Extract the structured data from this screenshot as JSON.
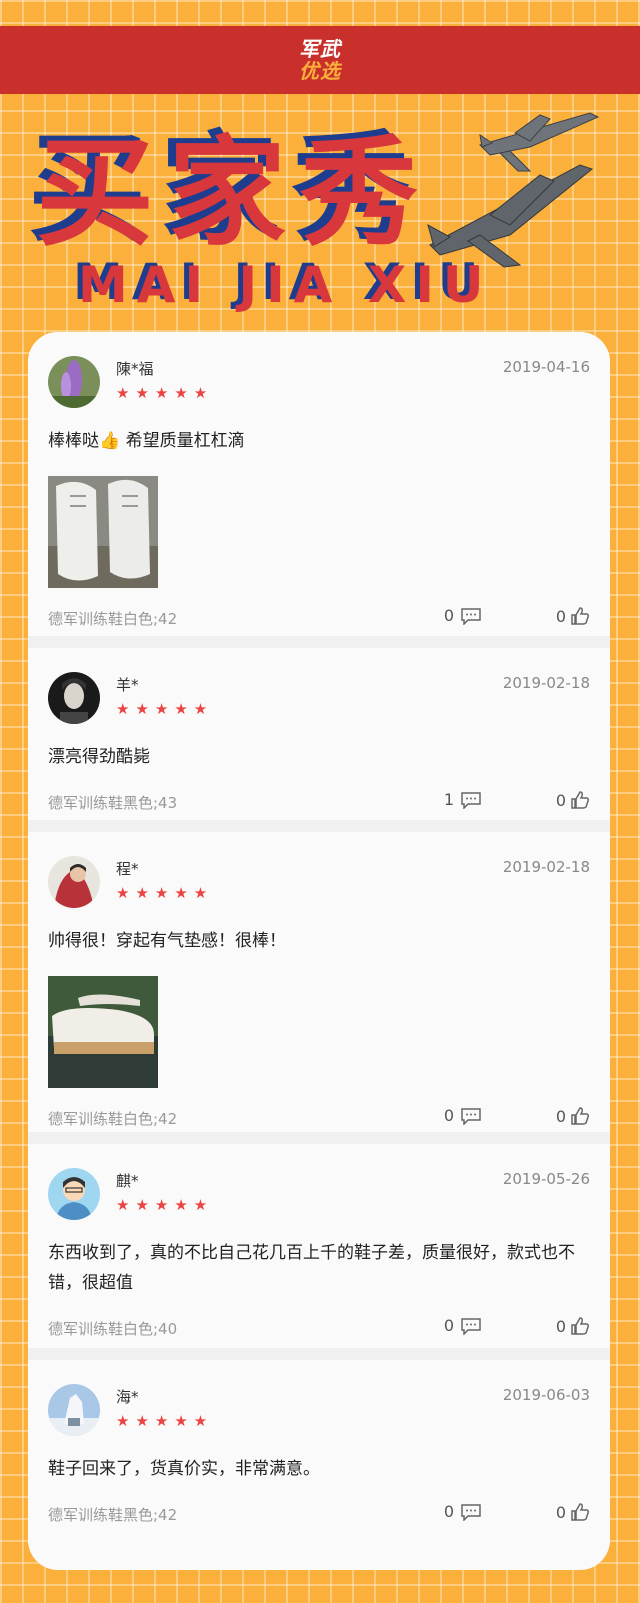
{
  "brand": {
    "line1": "军武",
    "line2": "优选"
  },
  "hero": {
    "title": "买家秀",
    "subtitle": "MAI JIA XIU"
  },
  "reviews": [
    {
      "user": "陳*福",
      "date": "2019-04-16",
      "stars": "★★★★★",
      "text": "棒棒哒👍 希望质量杠杠滴",
      "has_photo": true,
      "spec": "德军训练鞋白色;42",
      "comments": "0",
      "likes": "0"
    },
    {
      "user": "羊*",
      "date": "2019-02-18",
      "stars": "★★★★★",
      "text": "漂亮得劲酷毙",
      "has_photo": false,
      "spec": "德军训练鞋黑色;43",
      "comments": "1",
      "likes": "0"
    },
    {
      "user": "程*",
      "date": "2019-02-18",
      "stars": "★★★★★",
      "text": "帅得很！穿起有气垫感！很棒！",
      "has_photo": true,
      "spec": "德军训练鞋白色;42",
      "comments": "0",
      "likes": "0"
    },
    {
      "user": "麒*",
      "date": "2019-05-26",
      "stars": "★★★★★",
      "text": "东西收到了，真的不比自己花几百上千的鞋子差，质量很好，款式也不错，很超值",
      "has_photo": false,
      "spec": "德军训练鞋白色;40",
      "comments": "0",
      "likes": "0"
    },
    {
      "user": "海*",
      "date": "2019-06-03",
      "stars": "★★★★★",
      "text": "鞋子回来了，货真价实，非常满意。",
      "has_photo": false,
      "spec": "德军训练鞋黑色;42",
      "comments": "0",
      "likes": "0"
    }
  ],
  "colors": {
    "background": "#fbb03b",
    "banner": "#c9302c",
    "star": "#e94545",
    "title_red": "#d8373c",
    "title_blue": "#1e3d8f"
  }
}
